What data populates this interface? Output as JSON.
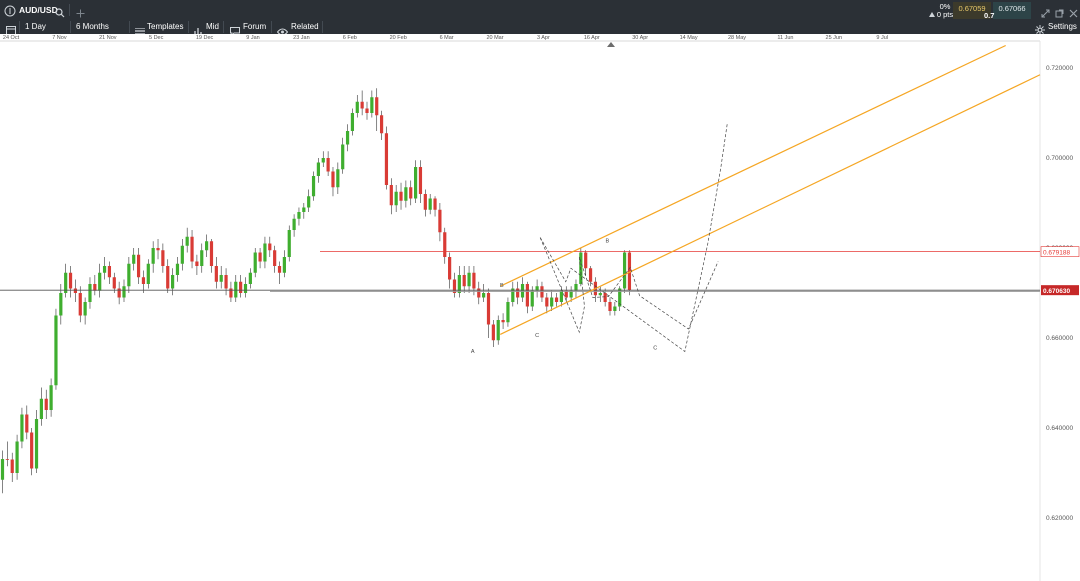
{
  "header": {
    "symbol": "AUD/USD",
    "change_pct": "0%",
    "change_pts": "0 pts",
    "bid": "0.67059",
    "ask": "0.67066",
    "spread": "0.7"
  },
  "toolbar": {
    "interval": "1 Day",
    "range": "6 Months",
    "templates": "Templates",
    "price_type": "Mid",
    "forum": "Forum",
    "related": "Related",
    "settings": "Settings"
  },
  "colors": {
    "up": "#3fae2f",
    "down": "#d93b35",
    "channel": "#f5a623",
    "hline_red": "#e53935",
    "current_line": "#555555",
    "price_tag": "#c62828"
  },
  "chart_data": {
    "type": "candlestick",
    "x_tick_labels": [
      "24 Oct",
      "7 Nov",
      "21 Nov",
      "5 Dec",
      "19 Dec",
      "9 Jan",
      "23 Jan",
      "6 Feb",
      "20 Feb",
      "6 Mar",
      "20 Mar",
      "3 Apr",
      "16 Apr",
      "30 Apr",
      "14 May",
      "28 May",
      "11 Jun",
      "25 Jun",
      "9 Jul"
    ],
    "y_tick_labels": [
      "0.720000",
      "0.700000",
      "0.680000",
      "0.660000",
      "0.640000",
      "0.620000"
    ],
    "y_ticks": [
      0.72,
      0.7,
      0.68,
      0.66,
      0.64,
      0.62
    ],
    "y_range": [
      0.6125,
      0.7245
    ],
    "current_price": 0.67063,
    "current_price_label": "0.670630",
    "horizontal_level": 0.679188,
    "horizontal_level_label": "0.679188",
    "wave_labels": [
      "A",
      "B",
      "C",
      "B",
      "C"
    ],
    "wave_points": [
      [
        0.6992,
        0.7075
      ],
      [
        0.693,
        0.6977
      ],
      [
        0.6805,
        0.6809
      ],
      [
        0.6585,
        0.657
      ],
      [
        0.549,
        0.6755
      ],
      [
        0.544,
        0.6725
      ],
      [
        0.519,
        0.6825
      ],
      [
        0.526,
        0.6787
      ],
      [
        0.5405,
        0.6705
      ],
      [
        0.557,
        0.6613
      ],
      [
        0.562,
        0.667
      ],
      [
        0.557,
        0.678
      ],
      [
        0.57,
        0.669
      ],
      [
        0.585,
        0.6692
      ],
      [
        0.606,
        0.6757
      ],
      [
        0.615,
        0.6694
      ],
      [
        0.662,
        0.662
      ],
      [
        0.6905,
        0.677
      ]
    ],
    "channel_lines": [
      {
        "from": [
          0.481,
          0.6715
        ],
        "to": [
          0.967,
          0.725
        ]
      },
      {
        "from": [
          0.481,
          0.6608
        ],
        "to": [
          1.0,
          0.7185
        ]
      }
    ],
    "candles": [
      [
        0.6285,
        0.6331,
        0.6255,
        0.635
      ],
      [
        0.6331,
        0.633,
        0.6315,
        0.637
      ],
      [
        0.633,
        0.63,
        0.628,
        0.6345
      ],
      [
        0.63,
        0.637,
        0.6285,
        0.6385
      ],
      [
        0.637,
        0.643,
        0.6355,
        0.6445
      ],
      [
        0.643,
        0.639,
        0.6375,
        0.645
      ],
      [
        0.639,
        0.631,
        0.6295,
        0.64
      ],
      [
        0.631,
        0.642,
        0.63,
        0.644
      ],
      [
        0.642,
        0.6465,
        0.6405,
        0.649
      ],
      [
        0.6465,
        0.644,
        0.642,
        0.6485
      ],
      [
        0.644,
        0.6495,
        0.6425,
        0.651
      ],
      [
        0.6495,
        0.665,
        0.6485,
        0.6665
      ],
      [
        0.665,
        0.67,
        0.663,
        0.672
      ],
      [
        0.67,
        0.6745,
        0.669,
        0.6765
      ],
      [
        0.6745,
        0.671,
        0.669,
        0.676
      ],
      [
        0.671,
        0.67,
        0.668,
        0.673
      ],
      [
        0.67,
        0.665,
        0.6635,
        0.6715
      ],
      [
        0.665,
        0.668,
        0.663,
        0.669
      ],
      [
        0.668,
        0.672,
        0.6665,
        0.6735
      ],
      [
        0.672,
        0.6705,
        0.6695,
        0.674
      ],
      [
        0.6705,
        0.6745,
        0.669,
        0.6765
      ],
      [
        0.6745,
        0.676,
        0.673,
        0.678
      ],
      [
        0.676,
        0.6735,
        0.672,
        0.677
      ],
      [
        0.6735,
        0.671,
        0.67,
        0.6745
      ],
      [
        0.671,
        0.669,
        0.6675,
        0.6725
      ],
      [
        0.669,
        0.6715,
        0.668,
        0.673
      ],
      [
        0.6715,
        0.6765,
        0.67,
        0.678
      ],
      [
        0.6765,
        0.6785,
        0.675,
        0.68
      ],
      [
        0.6785,
        0.6735,
        0.672,
        0.68
      ],
      [
        0.6735,
        0.672,
        0.67,
        0.675
      ],
      [
        0.672,
        0.6765,
        0.671,
        0.6775
      ],
      [
        0.6765,
        0.68,
        0.6745,
        0.6815
      ],
      [
        0.68,
        0.6795,
        0.6775,
        0.682
      ],
      [
        0.6795,
        0.676,
        0.6745,
        0.681
      ],
      [
        0.676,
        0.671,
        0.67,
        0.6775
      ],
      [
        0.671,
        0.674,
        0.6695,
        0.6755
      ],
      [
        0.674,
        0.6765,
        0.6725,
        0.678
      ],
      [
        0.6765,
        0.6805,
        0.675,
        0.682
      ],
      [
        0.6805,
        0.6825,
        0.679,
        0.6845
      ],
      [
        0.6825,
        0.677,
        0.6755,
        0.684
      ],
      [
        0.677,
        0.676,
        0.674,
        0.6785
      ],
      [
        0.676,
        0.6795,
        0.6745,
        0.681
      ],
      [
        0.6795,
        0.6815,
        0.678,
        0.683
      ],
      [
        0.6815,
        0.676,
        0.6745,
        0.682
      ],
      [
        0.676,
        0.6725,
        0.671,
        0.678
      ],
      [
        0.6725,
        0.674,
        0.671,
        0.676
      ],
      [
        0.674,
        0.671,
        0.6695,
        0.6755
      ],
      [
        0.671,
        0.669,
        0.668,
        0.6725
      ],
      [
        0.669,
        0.6725,
        0.668,
        0.674
      ],
      [
        0.6725,
        0.67,
        0.669,
        0.674
      ],
      [
        0.67,
        0.672,
        0.669,
        0.6735
      ],
      [
        0.672,
        0.6745,
        0.671,
        0.6755
      ],
      [
        0.6745,
        0.679,
        0.6735,
        0.68
      ],
      [
        0.679,
        0.677,
        0.6755,
        0.68
      ],
      [
        0.677,
        0.681,
        0.6755,
        0.6825
      ],
      [
        0.681,
        0.6795,
        0.678,
        0.6825
      ],
      [
        0.6795,
        0.676,
        0.6745,
        0.6805
      ],
      [
        0.676,
        0.6745,
        0.672,
        0.677
      ],
      [
        0.6745,
        0.678,
        0.6735,
        0.6795
      ],
      [
        0.678,
        0.684,
        0.677,
        0.685
      ],
      [
        0.684,
        0.6865,
        0.6825,
        0.6875
      ],
      [
        0.6865,
        0.688,
        0.685,
        0.689
      ],
      [
        0.688,
        0.689,
        0.6865,
        0.69
      ],
      [
        0.689,
        0.6915,
        0.688,
        0.693
      ],
      [
        0.6915,
        0.696,
        0.6905,
        0.697
      ],
      [
        0.696,
        0.699,
        0.6945,
        0.7
      ],
      [
        0.699,
        0.7,
        0.698,
        0.7015
      ],
      [
        0.7,
        0.697,
        0.696,
        0.7015
      ],
      [
        0.697,
        0.6935,
        0.6915,
        0.698
      ],
      [
        0.6935,
        0.6975,
        0.692,
        0.699
      ],
      [
        0.6975,
        0.703,
        0.6965,
        0.7045
      ],
      [
        0.703,
        0.706,
        0.7015,
        0.7075
      ],
      [
        0.706,
        0.71,
        0.705,
        0.711
      ],
      [
        0.71,
        0.7125,
        0.709,
        0.714
      ],
      [
        0.7125,
        0.711,
        0.7095,
        0.715
      ],
      [
        0.711,
        0.71,
        0.7085,
        0.7125
      ],
      [
        0.71,
        0.7135,
        0.709,
        0.715
      ],
      [
        0.7135,
        0.7095,
        0.706,
        0.7155
      ],
      [
        0.7095,
        0.7055,
        0.704,
        0.7105
      ],
      [
        0.7055,
        0.694,
        0.693,
        0.707
      ],
      [
        0.694,
        0.6895,
        0.6875,
        0.6955
      ],
      [
        0.6895,
        0.6925,
        0.688,
        0.694
      ],
      [
        0.6925,
        0.6905,
        0.6885,
        0.6945
      ],
      [
        0.6905,
        0.6935,
        0.689,
        0.695
      ],
      [
        0.6935,
        0.691,
        0.6895,
        0.695
      ],
      [
        0.691,
        0.698,
        0.69,
        0.6995
      ],
      [
        0.698,
        0.692,
        0.69,
        0.6995
      ],
      [
        0.692,
        0.6885,
        0.687,
        0.693
      ],
      [
        0.6885,
        0.691,
        0.6875,
        0.692
      ],
      [
        0.691,
        0.6885,
        0.687,
        0.6915
      ],
      [
        0.6885,
        0.6835,
        0.6815,
        0.69
      ],
      [
        0.6835,
        0.678,
        0.6765,
        0.6845
      ],
      [
        0.678,
        0.673,
        0.671,
        0.679
      ],
      [
        0.673,
        0.67,
        0.669,
        0.6745
      ],
      [
        0.67,
        0.674,
        0.669,
        0.676
      ],
      [
        0.674,
        0.6715,
        0.67,
        0.676
      ],
      [
        0.6715,
        0.6745,
        0.67,
        0.676
      ],
      [
        0.6745,
        0.671,
        0.6695,
        0.676
      ],
      [
        0.671,
        0.669,
        0.6675,
        0.6725
      ],
      [
        0.669,
        0.67,
        0.668,
        0.672
      ],
      [
        0.67,
        0.663,
        0.66,
        0.671
      ],
      [
        0.663,
        0.6595,
        0.658,
        0.664
      ],
      [
        0.6595,
        0.664,
        0.6585,
        0.665
      ],
      [
        0.664,
        0.6635,
        0.662,
        0.6655
      ],
      [
        0.6635,
        0.668,
        0.6625,
        0.669
      ],
      [
        0.668,
        0.671,
        0.667,
        0.6725
      ],
      [
        0.671,
        0.669,
        0.6675,
        0.6725
      ],
      [
        0.669,
        0.672,
        0.668,
        0.6735
      ],
      [
        0.672,
        0.667,
        0.6655,
        0.6725
      ],
      [
        0.667,
        0.6705,
        0.666,
        0.6715
      ],
      [
        0.6705,
        0.6715,
        0.669,
        0.673
      ],
      [
        0.6715,
        0.669,
        0.668,
        0.6725
      ],
      [
        0.669,
        0.667,
        0.6655,
        0.67
      ],
      [
        0.667,
        0.669,
        0.666,
        0.6705
      ],
      [
        0.669,
        0.668,
        0.667,
        0.67
      ],
      [
        0.668,
        0.6705,
        0.667,
        0.6715
      ],
      [
        0.6705,
        0.669,
        0.668,
        0.6715
      ],
      [
        0.669,
        0.6705,
        0.668,
        0.6715
      ],
      [
        0.6705,
        0.672,
        0.669,
        0.673
      ],
      [
        0.672,
        0.679,
        0.6715,
        0.68
      ],
      [
        0.679,
        0.6755,
        0.674,
        0.6795
      ],
      [
        0.6755,
        0.6725,
        0.6715,
        0.676
      ],
      [
        0.6725,
        0.6695,
        0.668,
        0.6735
      ],
      [
        0.6695,
        0.67,
        0.668,
        0.6715
      ],
      [
        0.67,
        0.668,
        0.667,
        0.671
      ],
      [
        0.668,
        0.666,
        0.665,
        0.669
      ],
      [
        0.666,
        0.667,
        0.665,
        0.668
      ],
      [
        0.667,
        0.671,
        0.666,
        0.6715
      ],
      [
        0.671,
        0.679,
        0.67,
        0.6795
      ],
      [
        0.679,
        0.6706,
        0.6695,
        0.6795
      ]
    ]
  }
}
